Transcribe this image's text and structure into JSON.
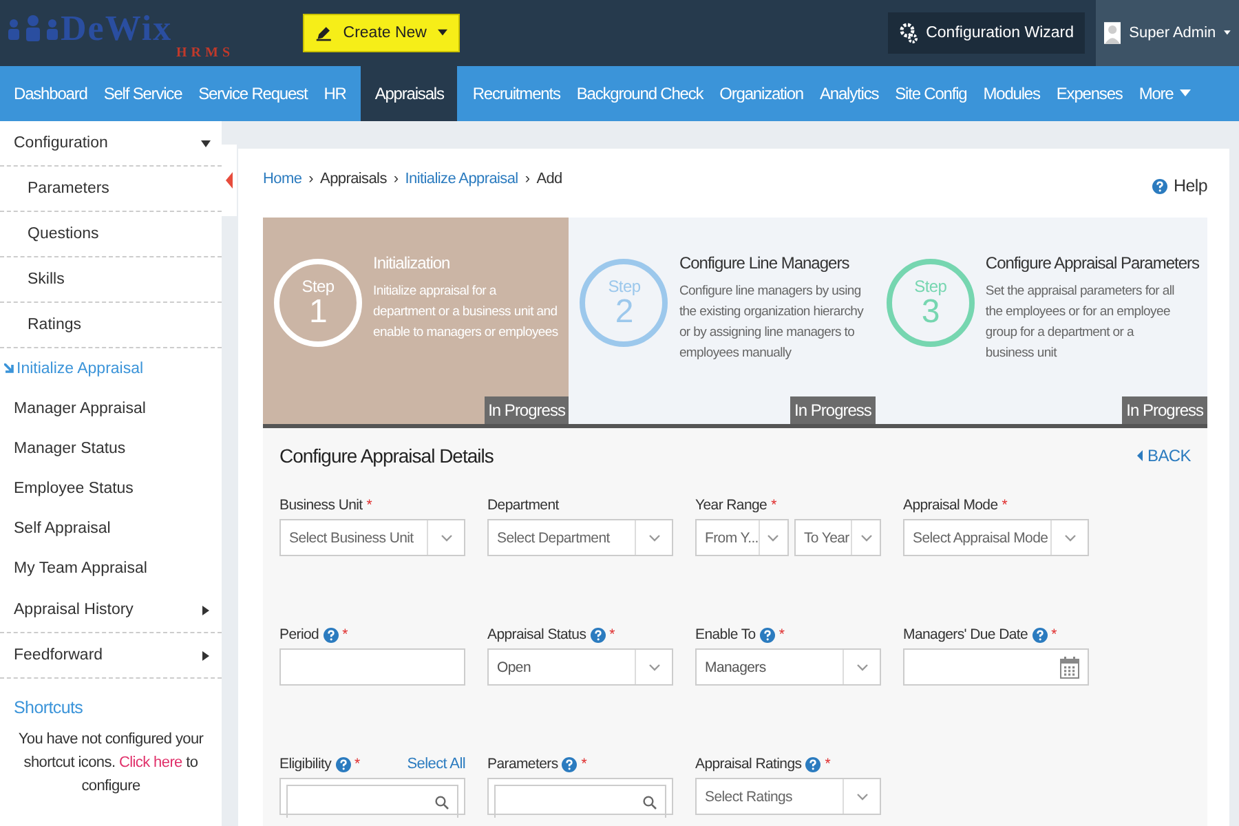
{
  "header": {
    "logo": "DeWix",
    "logo_sub": "HRMS",
    "create_button": "Create New",
    "wizard_button": "Configuration Wizard",
    "user": "Super Admin"
  },
  "nav": [
    {
      "label": "Dashboard",
      "selected": false
    },
    {
      "label": "Self Service",
      "selected": false
    },
    {
      "label": "Service Request",
      "selected": false
    },
    {
      "label": "HR",
      "selected": false
    },
    {
      "label": "Appraisals",
      "selected": true
    },
    {
      "label": "Recruitments",
      "selected": false
    },
    {
      "label": "Background Check",
      "selected": false
    },
    {
      "label": "Organization",
      "selected": false
    },
    {
      "label": "Analytics",
      "selected": false
    },
    {
      "label": "Site Config",
      "selected": false
    },
    {
      "label": "Modules",
      "selected": false
    },
    {
      "label": "Expenses",
      "selected": false
    },
    {
      "label": "More",
      "selected": false,
      "menu": true
    }
  ],
  "sidebar": {
    "items": [
      {
        "label": "Configuration",
        "selected": false,
        "expanded": true,
        "children": [
          {
            "label": "Parameters",
            "selected": false
          },
          {
            "label": "Questions",
            "selected": false
          },
          {
            "label": "Skills",
            "selected": false
          },
          {
            "label": "Ratings",
            "selected": false
          }
        ]
      },
      {
        "label": "Initialize Appraisal",
        "selected": true
      },
      {
        "label": "Manager Appraisal",
        "selected": false
      },
      {
        "label": "Manager Status",
        "selected": false
      },
      {
        "label": "Employee Status",
        "selected": false
      },
      {
        "label": "Self Appraisal",
        "selected": false
      },
      {
        "label": "My Team Appraisal",
        "selected": false
      },
      {
        "label": "Appraisal History",
        "selected": false,
        "expanded": false
      },
      {
        "label": "Feedforward",
        "selected": false,
        "expanded": false
      }
    ],
    "shortcuts_title": "Shortcuts",
    "shortcuts_before": "You have not configured your shortcut icons.",
    "shortcuts_link": "Click here",
    "shortcuts_after": "to configure"
  },
  "breadcrumb_separator": "›",
  "breadcrumb": [
    {
      "label": "Home",
      "link": true
    },
    {
      "label": "Appraisals",
      "link": false
    },
    {
      "label": "Initialize Appraisal",
      "link": true
    },
    {
      "label": "Add",
      "link": false
    }
  ],
  "help": "Help",
  "steps": [
    {
      "step_label": "Step",
      "number": "1",
      "title": "Initialization",
      "text": "Initialize appraisal for a department or a business unit and enable to managers or employees",
      "status": "In Progress",
      "selected": true,
      "color": "#ffffff"
    },
    {
      "step_label": "Step",
      "number": "2",
      "title": "Configure Line Managers",
      "text": "Configure line managers by using the existing organization hierarchy or by assigning line managers to employees manually",
      "status": "In Progress",
      "selected": false,
      "color": "#9cc8ec"
    },
    {
      "step_label": "Step",
      "number": "3",
      "title": "Configure Appraisal Parameters",
      "text": "Set the appraisal parameters for all the employees or for an employee group for a department or a business unit",
      "status": "In Progress",
      "selected": false,
      "color": "#76d6b0"
    }
  ],
  "form": {
    "title": "Configure Appraisal Details",
    "back": "BACK",
    "required_mark": "*",
    "rows": [
      [
        {
          "label": "Business Unit",
          "required": true,
          "help": false,
          "kind": "select",
          "placeholder": "Select Business Unit"
        },
        {
          "label": "Department",
          "required": false,
          "help": false,
          "kind": "select",
          "placeholder": "Select Department"
        },
        {
          "label": "Year Range",
          "required": true,
          "help": false,
          "kind": "range",
          "parts": [
            "From Y...",
            "To Year"
          ]
        },
        {
          "label": "Appraisal Mode",
          "required": true,
          "help": false,
          "kind": "select",
          "placeholder": "Select Appraisal Mode"
        }
      ],
      [
        {
          "label": "Period",
          "required": true,
          "help": true,
          "kind": "text"
        },
        {
          "label": "Appraisal Status",
          "required": true,
          "help": true,
          "kind": "select",
          "value": "Open"
        },
        {
          "label": "Enable To",
          "required": true,
          "help": true,
          "kind": "select",
          "value": "Managers"
        },
        {
          "label": "Managers' Due Date",
          "required": true,
          "help": true,
          "kind": "date"
        }
      ],
      [
        {
          "label": "Eligibility",
          "required": true,
          "help": true,
          "kind": "search",
          "link": "Select All"
        },
        {
          "label": "Parameters",
          "required": true,
          "help": true,
          "kind": "search"
        },
        {
          "label": "Appraisal Ratings",
          "required": true,
          "help": true,
          "kind": "select",
          "placeholder": "Select Ratings"
        }
      ]
    ]
  }
}
